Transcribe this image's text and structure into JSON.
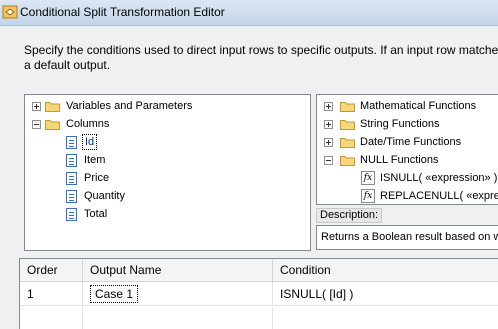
{
  "window": {
    "title": "Conditional Split Transformation Editor"
  },
  "instructions": {
    "line1": "Specify the conditions used to direct input rows to specific outputs. If an input row matche",
    "line2": "a default output."
  },
  "left_tree": {
    "variables_label": "Variables and Parameters",
    "columns_label": "Columns",
    "columns": [
      "Id",
      "Item",
      "Price",
      "Quantity",
      "Total"
    ]
  },
  "right_tree": {
    "categories": [
      "Mathematical Functions",
      "String Functions",
      "Date/Time Functions",
      "NULL Functions"
    ],
    "null_functions": [
      "ISNULL( «expression» )",
      "REPLACENULL( «expres"
    ]
  },
  "description": {
    "label": "Description:",
    "text": "Returns a Boolean result based on wh"
  },
  "grid": {
    "headers": {
      "order": "Order",
      "output_name": "Output Name",
      "condition": "Condition"
    },
    "rows": [
      {
        "order": "1",
        "output_name": "Case 1",
        "condition": "ISNULL( [Id]  )"
      }
    ]
  }
}
